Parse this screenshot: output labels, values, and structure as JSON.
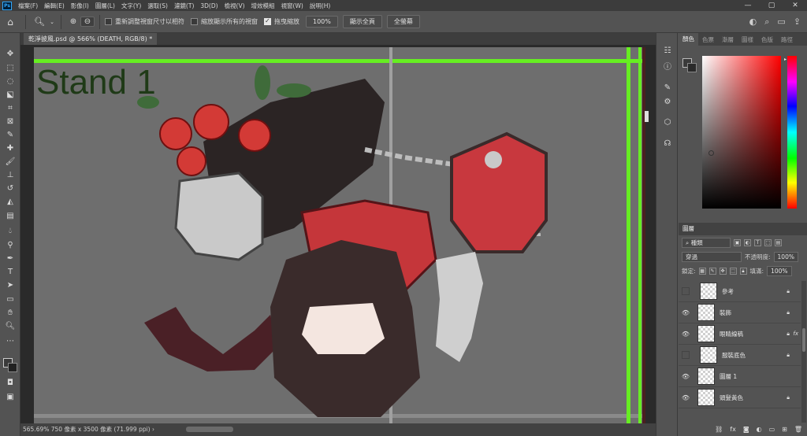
{
  "app": {
    "logo": "Ps"
  },
  "menu": [
    "檔案(F)",
    "編輯(E)",
    "影像(I)",
    "圖層(L)",
    "文字(Y)",
    "選取(S)",
    "濾鏡(T)",
    "3D(D)",
    "檢視(V)",
    "增效模組",
    "視窗(W)",
    "說明(H)"
  ],
  "window_controls": [
    "—",
    "▢",
    "✕"
  ],
  "options": {
    "check_resize": "重新調整視窗尺寸以相符",
    "check_zoom_all": "縮放顯示所有的視窗",
    "check_scrubby": "拖曳縮放",
    "zoom_value": "100%",
    "fit_screen": "顯示全頁",
    "fill_screen": "全螢幕"
  },
  "document": {
    "tab_title": "乾淨披風.psd @ 566% (DEATH, RGB/8) *"
  },
  "canvas": {
    "label": "Stand 1"
  },
  "status": {
    "text": "565.69%  750 像素 x 3500 像素 (71.999 ppi)  ›"
  },
  "color_panel": {
    "tabs": [
      "顏色",
      "色票",
      "漸層",
      "圖樣",
      "色版",
      "路徑"
    ],
    "active_tab": "顏色"
  },
  "layers_panel": {
    "title": "圖層",
    "filter": "種類",
    "blend_mode": "穿過",
    "opacity_label": "不透明度:",
    "opacity_value": "100%",
    "lock_label": "鎖定:",
    "fill_label": "填滿:",
    "fill_value": "100%",
    "layers": [
      {
        "name": "參考",
        "visible": false,
        "locked": true,
        "fx": false
      },
      {
        "name": "裝飾",
        "visible": true,
        "locked": true,
        "fx": false
      },
      {
        "name": "眼睛線稿",
        "visible": true,
        "locked": true,
        "fx": true
      },
      {
        "name": "服裝底色",
        "visible": false,
        "locked": true,
        "fx": false
      },
      {
        "name": "圖層 1",
        "visible": true,
        "locked": false,
        "fx": false
      },
      {
        "name": "頭髮黃色",
        "visible": true,
        "locked": true,
        "fx": false
      }
    ]
  },
  "colors": {
    "guide_green": "#66ee22",
    "bg": "#535353",
    "canvas_gray": "#6e6e6e"
  }
}
